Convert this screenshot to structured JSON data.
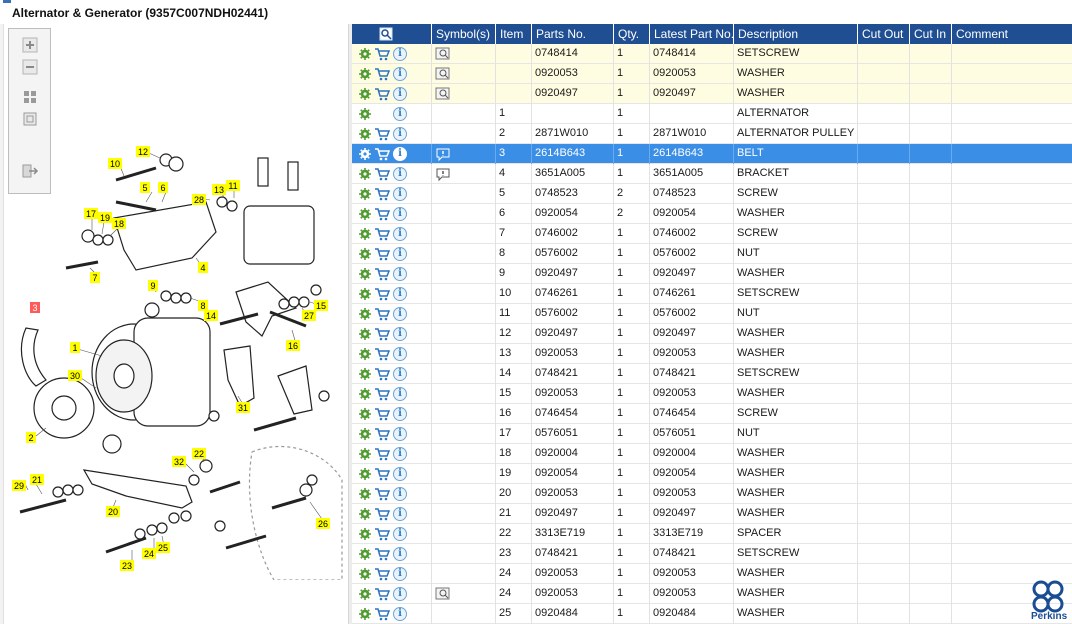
{
  "title": "Alternator & Generator (9357C007NDH02441)",
  "toolbar": {
    "zoom_in_icon": "plus",
    "zoom_out_icon": "minus",
    "fit_icon": "grid",
    "actual_size_icon": "square",
    "export_icon": "export-arrow"
  },
  "columns": [
    "",
    "Symbol(s)",
    "Item",
    "Parts No.",
    "Qty.",
    "Latest Part No.",
    "Description",
    "Cut Out",
    "Cut In",
    "Comment"
  ],
  "rows": [
    {
      "highlight": "yellow",
      "cart": true,
      "symbol": "doc",
      "item": "",
      "part": "0748414",
      "qty": "1",
      "latest": "0748414",
      "desc": "SETSCREW"
    },
    {
      "highlight": "yellow",
      "cart": true,
      "symbol": "doc",
      "item": "",
      "part": "0920053",
      "qty": "1",
      "latest": "0920053",
      "desc": "WASHER"
    },
    {
      "highlight": "yellow",
      "cart": true,
      "symbol": "doc",
      "item": "",
      "part": "0920497",
      "qty": "1",
      "latest": "0920497",
      "desc": "WASHER"
    },
    {
      "highlight": "",
      "cart": false,
      "symbol": "",
      "item": "1",
      "part": "",
      "qty": "1",
      "latest": "",
      "desc": "ALTERNATOR"
    },
    {
      "highlight": "",
      "cart": true,
      "symbol": "",
      "item": "2",
      "part": "2871W010",
      "qty": "1",
      "latest": "2871W010",
      "desc": "ALTERNATOR PULLEY"
    },
    {
      "highlight": "selected",
      "cart": true,
      "symbol": "note",
      "item": "3",
      "part": "2614B643",
      "qty": "1",
      "latest": "2614B643",
      "desc": "BELT"
    },
    {
      "highlight": "",
      "cart": true,
      "symbol": "note",
      "item": "4",
      "part": "3651A005",
      "qty": "1",
      "latest": "3651A005",
      "desc": "BRACKET"
    },
    {
      "highlight": "",
      "cart": true,
      "symbol": "",
      "item": "5",
      "part": "0748523",
      "qty": "2",
      "latest": "0748523",
      "desc": "SCREW"
    },
    {
      "highlight": "",
      "cart": true,
      "symbol": "",
      "item": "6",
      "part": "0920054",
      "qty": "2",
      "latest": "0920054",
      "desc": "WASHER"
    },
    {
      "highlight": "",
      "cart": true,
      "symbol": "",
      "item": "7",
      "part": "0746002",
      "qty": "1",
      "latest": "0746002",
      "desc": "SCREW"
    },
    {
      "highlight": "",
      "cart": true,
      "symbol": "",
      "item": "8",
      "part": "0576002",
      "qty": "1",
      "latest": "0576002",
      "desc": "NUT"
    },
    {
      "highlight": "",
      "cart": true,
      "symbol": "",
      "item": "9",
      "part": "0920497",
      "qty": "1",
      "latest": "0920497",
      "desc": "WASHER"
    },
    {
      "highlight": "",
      "cart": true,
      "symbol": "",
      "item": "10",
      "part": "0746261",
      "qty": "1",
      "latest": "0746261",
      "desc": "SETSCREW"
    },
    {
      "highlight": "",
      "cart": true,
      "symbol": "",
      "item": "11",
      "part": "0576002",
      "qty": "1",
      "latest": "0576002",
      "desc": "NUT"
    },
    {
      "highlight": "",
      "cart": true,
      "symbol": "",
      "item": "12",
      "part": "0920497",
      "qty": "1",
      "latest": "0920497",
      "desc": "WASHER"
    },
    {
      "highlight": "",
      "cart": true,
      "symbol": "",
      "item": "13",
      "part": "0920053",
      "qty": "1",
      "latest": "0920053",
      "desc": "WASHER"
    },
    {
      "highlight": "",
      "cart": true,
      "symbol": "",
      "item": "14",
      "part": "0748421",
      "qty": "1",
      "latest": "0748421",
      "desc": "SETSCREW"
    },
    {
      "highlight": "",
      "cart": true,
      "symbol": "",
      "item": "15",
      "part": "0920053",
      "qty": "1",
      "latest": "0920053",
      "desc": "WASHER"
    },
    {
      "highlight": "",
      "cart": true,
      "symbol": "",
      "item": "16",
      "part": "0746454",
      "qty": "1",
      "latest": "0746454",
      "desc": "SCREW"
    },
    {
      "highlight": "",
      "cart": true,
      "symbol": "",
      "item": "17",
      "part": "0576051",
      "qty": "1",
      "latest": "0576051",
      "desc": "NUT"
    },
    {
      "highlight": "",
      "cart": true,
      "symbol": "",
      "item": "18",
      "part": "0920004",
      "qty": "1",
      "latest": "0920004",
      "desc": "WASHER"
    },
    {
      "highlight": "",
      "cart": true,
      "symbol": "",
      "item": "19",
      "part": "0920054",
      "qty": "1",
      "latest": "0920054",
      "desc": "WASHER"
    },
    {
      "highlight": "",
      "cart": true,
      "symbol": "",
      "item": "20",
      "part": "0920053",
      "qty": "1",
      "latest": "0920053",
      "desc": "WASHER"
    },
    {
      "highlight": "",
      "cart": true,
      "symbol": "",
      "item": "21",
      "part": "0920497",
      "qty": "1",
      "latest": "0920497",
      "desc": "WASHER"
    },
    {
      "highlight": "",
      "cart": true,
      "symbol": "",
      "item": "22",
      "part": "3313E719",
      "qty": "1",
      "latest": "3313E719",
      "desc": "SPACER"
    },
    {
      "highlight": "",
      "cart": true,
      "symbol": "",
      "item": "23",
      "part": "0748421",
      "qty": "1",
      "latest": "0748421",
      "desc": "SETSCREW"
    },
    {
      "highlight": "",
      "cart": true,
      "symbol": "",
      "item": "24",
      "part": "0920053",
      "qty": "1",
      "latest": "0920053",
      "desc": "WASHER"
    },
    {
      "highlight": "",
      "cart": true,
      "symbol": "doc",
      "item": "24",
      "part": "0920053",
      "qty": "1",
      "latest": "0920053",
      "desc": "WASHER"
    },
    {
      "highlight": "",
      "cart": true,
      "symbol": "",
      "item": "25",
      "part": "0920484",
      "qty": "1",
      "latest": "0920484",
      "desc": "WASHER"
    }
  ],
  "diagram_labels": [
    "1",
    "2",
    "3",
    "4",
    "5",
    "6",
    "7",
    "8",
    "9",
    "10",
    "11",
    "12",
    "13",
    "14",
    "15",
    "16",
    "17",
    "18",
    "19",
    "20",
    "21",
    "22",
    "23",
    "24",
    "25",
    "26",
    "27",
    "28",
    "29",
    "30",
    "31",
    "32"
  ],
  "logo_text": "Perkins",
  "colors": {
    "header": "#1f4f92",
    "selected": "#3b8ee6",
    "yellow_row": "#fffde1",
    "label_bg": "#ffff00",
    "selected_label": "#ff5a5a",
    "logo": "#1a4d93"
  }
}
